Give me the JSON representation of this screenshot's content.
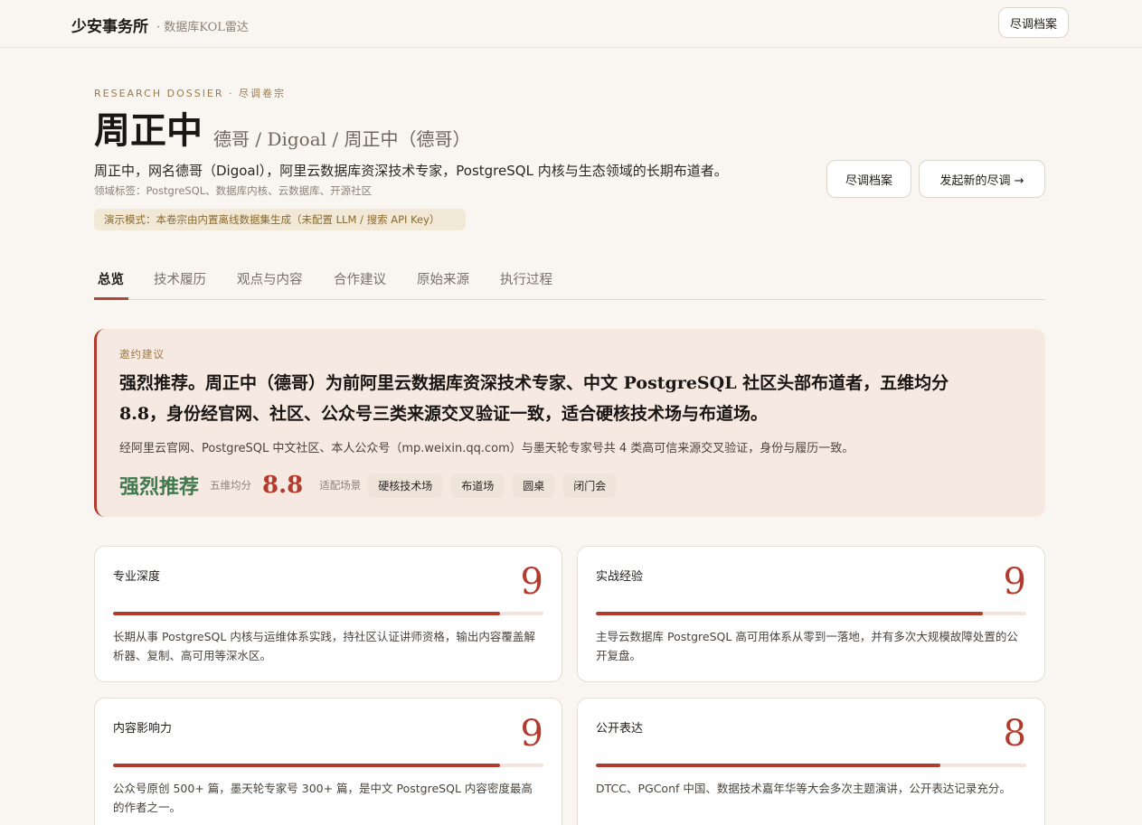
{
  "topbar": {
    "brand": "少安事务所",
    "subtitle": "· 数据库KOL雷达",
    "archive_button": "尽调档案"
  },
  "header": {
    "eyebrow": "RESEARCH DOSSIER · 尽调卷宗",
    "name": "周正中",
    "aliases": "德哥 / Digoal / 周正中（德哥）",
    "summary": "周正中，网名德哥（Digoal），阿里云数据库资深技术专家，PostgreSQL 内核与生态领域的长期布道者。",
    "domain_tags": "领域标签：PostgreSQL、数据库内核、云数据库、开源社区",
    "demo_notice": "演示模式：本卷宗由内置离线数据集生成（未配置 LLM / 搜索 API Key）",
    "archive_button": "尽调档案",
    "new_button": "发起新的尽调 →"
  },
  "tabs": [
    "总览",
    "技术履历",
    "观点与内容",
    "合作建议",
    "原始来源",
    "执行过程"
  ],
  "active_tab": 0,
  "recommendation": {
    "label": "邀约建议",
    "headline": "强烈推荐。周正中（德哥）为前阿里云数据库资深技术专家、中文 PostgreSQL 社区头部布道者，五维均分 8.8，身份经官网、社区、公众号三类来源交叉验证一致，适合硬核技术场与布道场。",
    "evidence": "经阿里云官网、PostgreSQL 中文社区、本人公众号（mp.weixin.qq.com）与墨天轮专家号共 4 类高可信来源交叉验证，身份与履历一致。",
    "verdict": "强烈推荐",
    "avg_label": "五维均分",
    "avg_score": "8.8",
    "scene_label": "适配场景",
    "scenes": [
      "硬核技术场",
      "布道场",
      "圆桌",
      "闭门会"
    ]
  },
  "dimensions": [
    {
      "label": "专业深度",
      "score": "9",
      "fraction": 0.9,
      "desc": "长期从事 PostgreSQL 内核与运维体系实践，持社区认证讲师资格，输出内容覆盖解析器、复制、高可用等深水区。"
    },
    {
      "label": "实战经验",
      "score": "9",
      "fraction": 0.9,
      "desc": "主导云数据库 PostgreSQL 高可用体系从零到一落地，并有多次大规模故障处置的公开复盘。"
    },
    {
      "label": "内容影响力",
      "score": "9",
      "fraction": 0.9,
      "desc": "公众号原创 500+ 篇，墨天轮专家号 300+ 篇，是中文 PostgreSQL 内容密度最高的作者之一。"
    },
    {
      "label": "公开表达",
      "score": "8",
      "fraction": 0.8,
      "desc": "DTCC、PGConf 中国、数据技术嘉年华等大会多次主题演讲，公开表达记录充分。"
    }
  ],
  "colors": {
    "background": "#f9f5f0",
    "accent": "#b23b2e",
    "verdict": "#3f7a4e",
    "eyebrow": "#9a7a4a"
  }
}
